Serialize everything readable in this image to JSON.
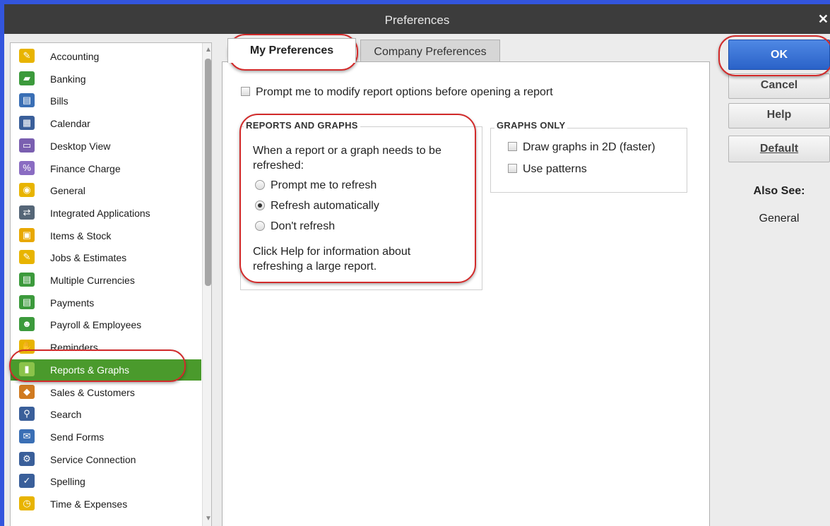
{
  "window": {
    "title": "Preferences",
    "close_label": "✕"
  },
  "sidebar": {
    "items": [
      {
        "label": "Accounting",
        "icon": "accounting-icon",
        "color": "#e8b400"
      },
      {
        "label": "Banking",
        "icon": "banking-icon",
        "color": "#3c9a3c"
      },
      {
        "label": "Bills",
        "icon": "bills-icon",
        "color": "#3a6fb5"
      },
      {
        "label": "Calendar",
        "icon": "calendar-icon",
        "color": "#3a5f9a"
      },
      {
        "label": "Desktop View",
        "icon": "desktop-view-icon",
        "color": "#7a5fb0"
      },
      {
        "label": "Finance Charge",
        "icon": "finance-charge-icon",
        "color": "#8a6cc2"
      },
      {
        "label": "General",
        "icon": "general-icon",
        "color": "#e8b400"
      },
      {
        "label": "Integrated Applications",
        "icon": "integrated-applications-icon",
        "color": "#556677"
      },
      {
        "label": "Items & Stock",
        "icon": "items-stock-icon",
        "color": "#e8a800"
      },
      {
        "label": "Jobs & Estimates",
        "icon": "jobs-estimates-icon",
        "color": "#e8b400"
      },
      {
        "label": "Multiple Currencies",
        "icon": "multiple-currencies-icon",
        "color": "#3c9a3c"
      },
      {
        "label": "Payments",
        "icon": "payments-icon",
        "color": "#3c9a3c"
      },
      {
        "label": "Payroll & Employees",
        "icon": "payroll-employees-icon",
        "color": "#3c9a3c"
      },
      {
        "label": "Reminders",
        "icon": "reminders-icon",
        "color": "#e8b400"
      },
      {
        "label": "Reports & Graphs",
        "icon": "reports-graphs-icon",
        "color": "#8bc34a",
        "selected": true
      },
      {
        "label": "Sales & Customers",
        "icon": "sales-customers-icon",
        "color": "#d07a20"
      },
      {
        "label": "Search",
        "icon": "search-icon",
        "color": "#3a5f9a"
      },
      {
        "label": "Send Forms",
        "icon": "send-forms-icon",
        "color": "#3a6fb5"
      },
      {
        "label": "Service Connection",
        "icon": "service-connection-icon",
        "color": "#3a5f9a"
      },
      {
        "label": "Spelling",
        "icon": "spelling-icon",
        "color": "#3a5f9a"
      },
      {
        "label": "Time & Expenses",
        "icon": "time-expenses-icon",
        "color": "#e8b400"
      }
    ]
  },
  "tabs": {
    "my_preferences": "My Preferences",
    "company_preferences": "Company Preferences",
    "active": "my_preferences"
  },
  "my_prefs": {
    "prompt_modify_label": "Prompt me to modify report options before opening a report",
    "prompt_modify_checked": false,
    "reports_graphs": {
      "title": "REPORTS AND GRAPHS",
      "intro_line1": "When a report or a graph needs to be",
      "intro_line2": "refreshed:",
      "options": [
        {
          "label": "Prompt me to refresh",
          "checked": false
        },
        {
          "label": "Refresh automatically",
          "checked": true
        },
        {
          "label": "Don't refresh",
          "checked": false
        }
      ],
      "help_line1": "Click Help for information about",
      "help_line2": "refreshing a large report."
    },
    "graphs_only": {
      "title": "GRAPHS ONLY",
      "draw_2d_label": "Draw graphs in 2D (faster)",
      "draw_2d_checked": false,
      "use_patterns_label": "Use patterns",
      "use_patterns_checked": false
    }
  },
  "buttons": {
    "ok": "OK",
    "cancel": "Cancel",
    "help": "Help",
    "default": "Default"
  },
  "also_see": {
    "title": "Also See:",
    "link": "General"
  },
  "colors": {
    "title_bar": "#3c3c3c",
    "selected_item": "#4a9a2c",
    "ok_button": "#2a62c8",
    "annotation": "#d12a2a",
    "window_border": "#3355dd"
  }
}
